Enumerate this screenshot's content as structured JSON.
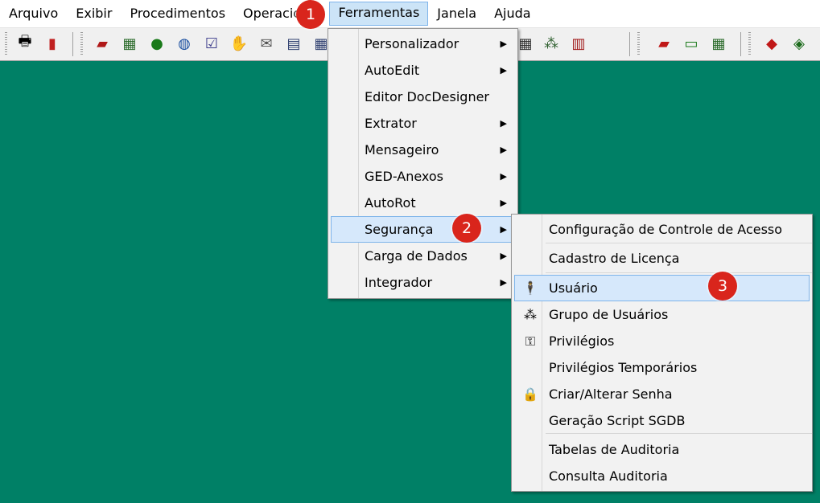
{
  "menubar": {
    "items": [
      "Arquivo",
      "Exibir",
      "Procedimentos",
      "Operacional",
      "Ferramentas",
      "Janela",
      "Ajuda"
    ],
    "active_index": 4
  },
  "toolbar": {
    "left_icons": [
      "printer-icon",
      "exit-door-icon"
    ],
    "group1_icons": [
      "truck-icon",
      "map-icon",
      "money-bag-icon",
      "globe-icon",
      "checklist-icon",
      "handshake-icon",
      "envelope-icon",
      "document-icon",
      "calculator-icon"
    ],
    "group2_icons": [
      "grid-icon",
      "chart-icon",
      "books-icon"
    ],
    "group3_icons": [
      "delivery-truck-icon",
      "ticket-icon",
      "map2-icon"
    ],
    "group4_icons": [
      "tag-icon",
      "tag-settings-icon"
    ]
  },
  "ferramentas_menu": {
    "items": [
      {
        "label": "Personalizador",
        "submenu": true
      },
      {
        "label": "AutoEdit",
        "submenu": true
      },
      {
        "label": "Editor DocDesigner",
        "submenu": false
      },
      {
        "label": "Extrator",
        "submenu": true
      },
      {
        "label": "Mensageiro",
        "submenu": true
      },
      {
        "label": "GED-Anexos",
        "submenu": true
      },
      {
        "label": "AutoRot",
        "submenu": true
      },
      {
        "label": "Segurança",
        "submenu": true
      },
      {
        "label": "Carga de Dados",
        "submenu": true
      },
      {
        "label": "Integrador",
        "submenu": true
      }
    ],
    "highlighted_index": 7
  },
  "seguranca_menu": {
    "items": [
      {
        "label": "Configuração de Controle de Acesso",
        "icon": ""
      },
      {
        "label": "Cadastro de Licença",
        "icon": ""
      },
      {
        "label": "Usuário",
        "icon": "person-icon"
      },
      {
        "label": "Grupo de Usuários",
        "icon": "user-group-icon"
      },
      {
        "label": "Privilégios",
        "icon": "key-icon"
      },
      {
        "label": "Privilégios Temporários",
        "icon": ""
      },
      {
        "label": "Criar/Alterar Senha",
        "icon": "padlock-icon"
      },
      {
        "label": "Geração Script SGDB",
        "icon": ""
      },
      {
        "label": "Tabelas de Auditoria",
        "icon": ""
      },
      {
        "label": "Consulta Auditoria",
        "icon": ""
      }
    ],
    "highlighted_index": 2
  },
  "badges": [
    "1",
    "2",
    "3"
  ],
  "colors": {
    "workspace": "#008066",
    "highlight": "#d6e8fb",
    "badge": "#d9251c"
  }
}
